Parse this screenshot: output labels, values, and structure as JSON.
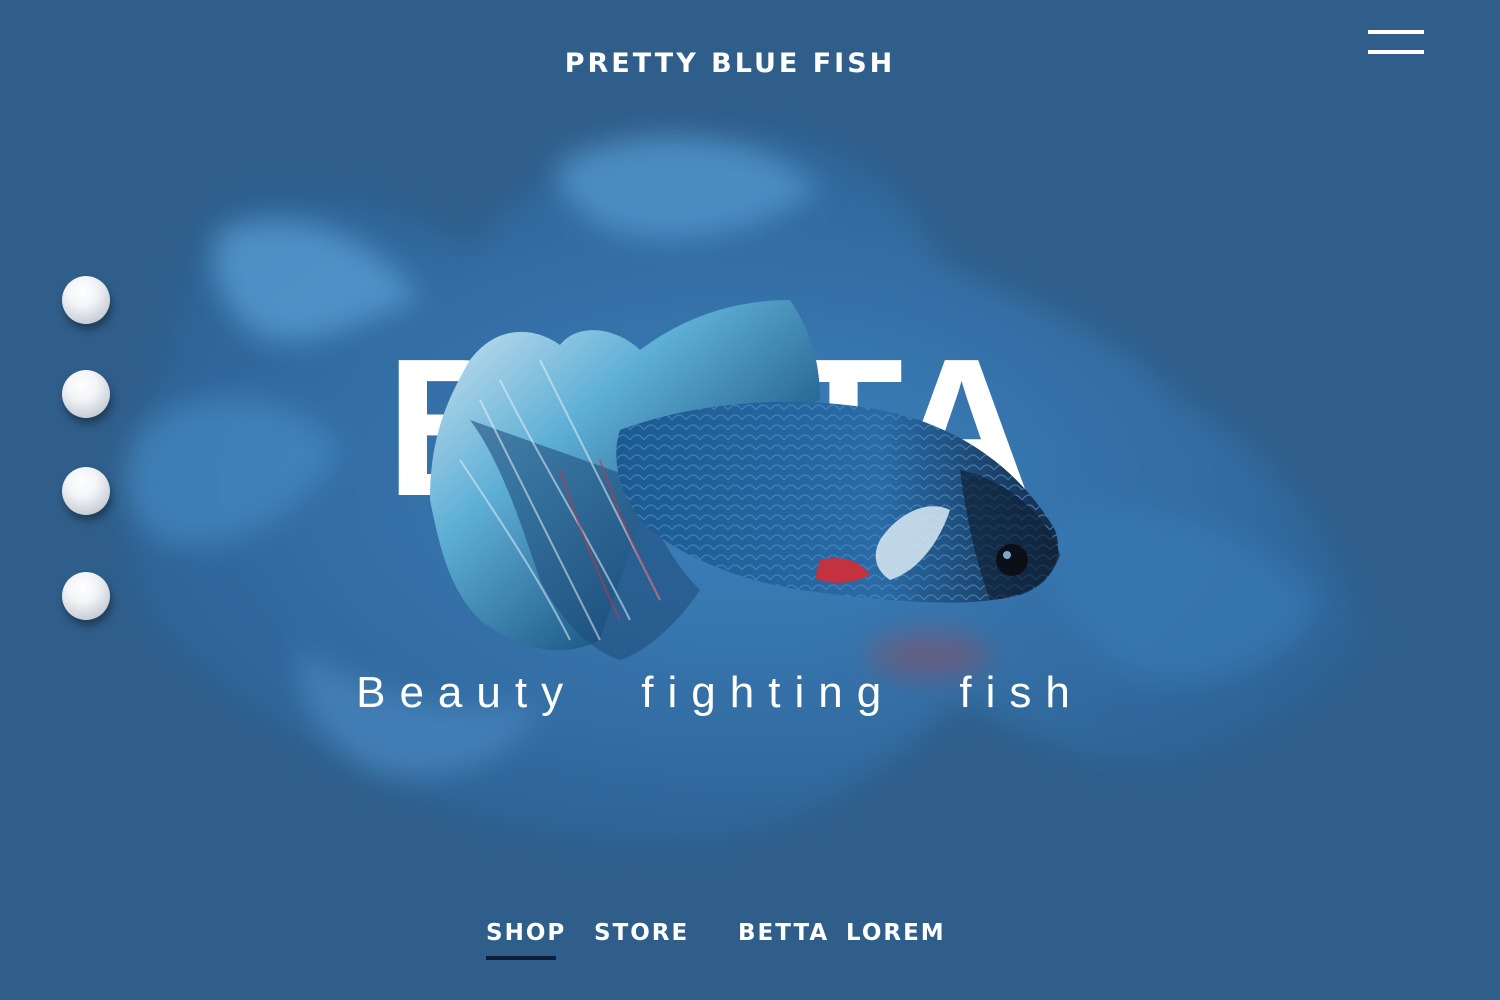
{
  "header": {
    "site_title": "PRETTY BLUE FISH",
    "menu_icon": "hamburger-menu-icon"
  },
  "slider": {
    "dot_count": 4,
    "active_index": 0
  },
  "hero": {
    "word": "BETTA",
    "tagline": "Beauty fighting fish"
  },
  "nav": {
    "items": [
      "SHOP",
      "STORE",
      "BETTA",
      "LOREM"
    ],
    "active": "SHOP"
  },
  "colors": {
    "background": "#2f5e8a",
    "text": "#ffffff",
    "active_underline": "#0d1e3a"
  }
}
